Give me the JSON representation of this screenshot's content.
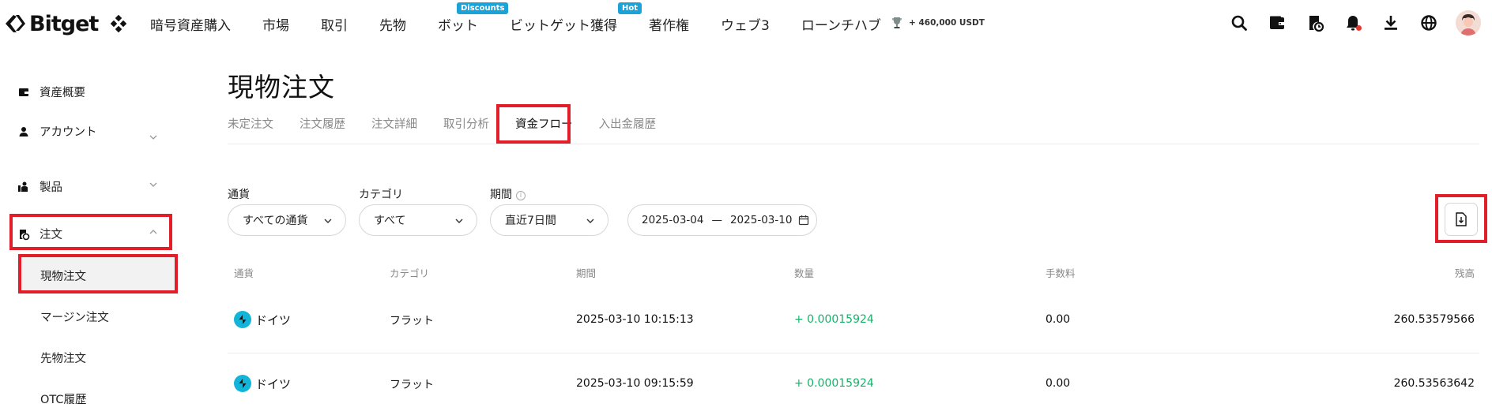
{
  "nav": {
    "brand": "Bitget",
    "items": [
      {
        "label": "暗号資産購入"
      },
      {
        "label": "市場"
      },
      {
        "label": "取引"
      },
      {
        "label": "先物"
      },
      {
        "label": "ボット",
        "badge": "Discounts"
      },
      {
        "label": "ビットゲット獲得",
        "badge": "Hot"
      },
      {
        "label": "著作権"
      },
      {
        "label": "ウェブ3"
      },
      {
        "label": "ローンチハブ"
      }
    ],
    "promo": "+ 460,000 USDT",
    "icons": [
      "search-icon",
      "wallet-icon",
      "orders-icon",
      "bell-icon",
      "download-icon",
      "globe-icon",
      "avatar"
    ]
  },
  "sidebar": {
    "items": [
      {
        "label": "資産概要",
        "icon": "wallet-icon"
      },
      {
        "label": "アカウント",
        "icon": "person-icon"
      },
      {
        "label": "製品",
        "icon": "products-icon"
      },
      {
        "label": "注文",
        "icon": "orders-icon"
      }
    ],
    "sub_items": [
      {
        "label": "現物注文"
      },
      {
        "label": "マージン注文"
      },
      {
        "label": "先物注文"
      },
      {
        "label": "OTC履歴"
      }
    ]
  },
  "main": {
    "title": "現物注文",
    "tabs": [
      {
        "label": "未定注文"
      },
      {
        "label": "注文履歴"
      },
      {
        "label": "注文詳細"
      },
      {
        "label": "取引分析"
      },
      {
        "label": "資金フロー"
      },
      {
        "label": "入出金履歴"
      }
    ],
    "active_tab": "資金フロー",
    "filters": {
      "currency": {
        "label": "通貨",
        "value": "すべての通貨"
      },
      "category": {
        "label": "カテゴリ",
        "value": "すべて"
      },
      "period": {
        "label": "期間",
        "value": "直近7日間"
      },
      "date_from": "2025-03-04",
      "date_sep": "—",
      "date_to": "2025-03-10"
    },
    "table": {
      "headers": [
        "通貨",
        "カテゴリ",
        "期間",
        "数量",
        "手数料",
        "残高"
      ],
      "rows": [
        {
          "currency": "ドイツ",
          "category": "フラット",
          "time": "2025-03-10 10:15:13",
          "amount": "+ 0.00015924",
          "fee": "0.00",
          "balance": "260.53579566"
        },
        {
          "currency": "ドイツ",
          "category": "フラット",
          "time": "2025-03-10 09:15:59",
          "amount": "+ 0.00015924",
          "fee": "0.00",
          "balance": "260.53563642"
        }
      ]
    }
  },
  "colors": {
    "accent_green": "#17b26a",
    "highlight_red": "#e11e2a",
    "coin_blue": "#12b5d8",
    "badge_blue": "#1aa3d9"
  }
}
